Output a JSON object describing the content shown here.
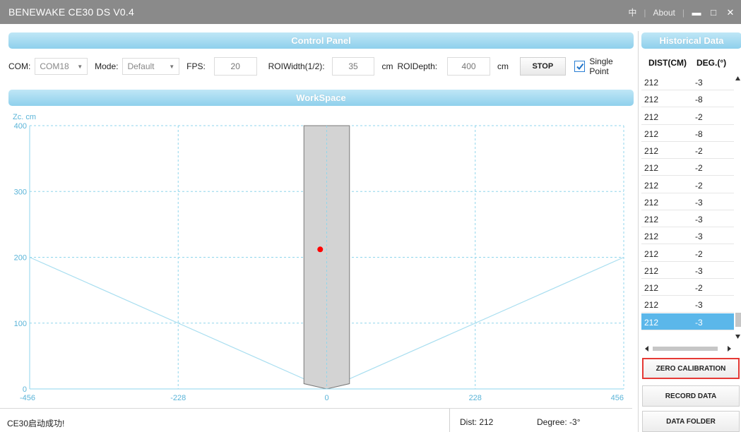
{
  "window": {
    "title": "BENEWAKE CE30 DS V0.4",
    "lang": "中",
    "about": "About",
    "min_glyph": "▬",
    "max_glyph": "□",
    "close_glyph": "✕"
  },
  "control_panel": {
    "header": "Control Panel",
    "com_label": "COM:",
    "com_value": "COM18",
    "mode_label": "Mode:",
    "mode_value": "Default",
    "fps_label": "FPS:",
    "fps_value": "20",
    "roi_width_label": "ROIWidth(1/2):",
    "roi_width_value": "35",
    "roi_width_unit": "cm",
    "roi_depth_label": "ROIDepth:",
    "roi_depth_value": "400",
    "roi_depth_unit": "cm",
    "stop_label": "STOP",
    "single_point_label": "Single Point",
    "single_point_checked": true
  },
  "workspace": {
    "header": "WorkSpace"
  },
  "chart_data": {
    "type": "scatter",
    "ylabel": "Zc. cm",
    "xlim": [
      -456,
      456
    ],
    "ylim": [
      0,
      400
    ],
    "x_ticks": [
      "-456",
      "-228",
      "0",
      "228",
      "456"
    ],
    "y_ticks": [
      "0",
      "100",
      "200",
      "300",
      "400"
    ],
    "grid": true,
    "roi_half_width": 35,
    "roi_depth": 400,
    "fov_lines": [
      [
        [
          -456,
          200
        ],
        [
          0,
          0
        ],
        [
          456,
          200
        ]
      ]
    ],
    "points": [
      {
        "x": -10,
        "y": 212
      }
    ],
    "colors": {
      "grid": "#8fd6ec",
      "fov": "#a8def0",
      "roi_fill": "#d3d3d3",
      "roi_stroke": "#7a7a7a",
      "point": "#ff0000"
    }
  },
  "status": {
    "message": "CE30启动成功!",
    "dist": "Dist:  212",
    "degree": "Degree:  -3°"
  },
  "history": {
    "header": "Historical Data",
    "col_dist": "DIST(CM)",
    "col_deg": "DEG.(°)",
    "rows": [
      {
        "dist": "212",
        "deg": "-3"
      },
      {
        "dist": "212",
        "deg": "-8"
      },
      {
        "dist": "212",
        "deg": "-2"
      },
      {
        "dist": "212",
        "deg": "-8"
      },
      {
        "dist": "212",
        "deg": "-2"
      },
      {
        "dist": "212",
        "deg": "-2"
      },
      {
        "dist": "212",
        "deg": "-2"
      },
      {
        "dist": "212",
        "deg": "-3"
      },
      {
        "dist": "212",
        "deg": "-3"
      },
      {
        "dist": "212",
        "deg": "-3"
      },
      {
        "dist": "212",
        "deg": "-2"
      },
      {
        "dist": "212",
        "deg": "-3"
      },
      {
        "dist": "212",
        "deg": "-2"
      },
      {
        "dist": "212",
        "deg": "-3"
      },
      {
        "dist": "212",
        "deg": "-3"
      }
    ],
    "selected_row": 14
  },
  "buttons": {
    "zero_calibration": "ZERO CALIBRATION",
    "record_data": "RECORD DATA",
    "data_folder": "DATA FOLDER"
  }
}
